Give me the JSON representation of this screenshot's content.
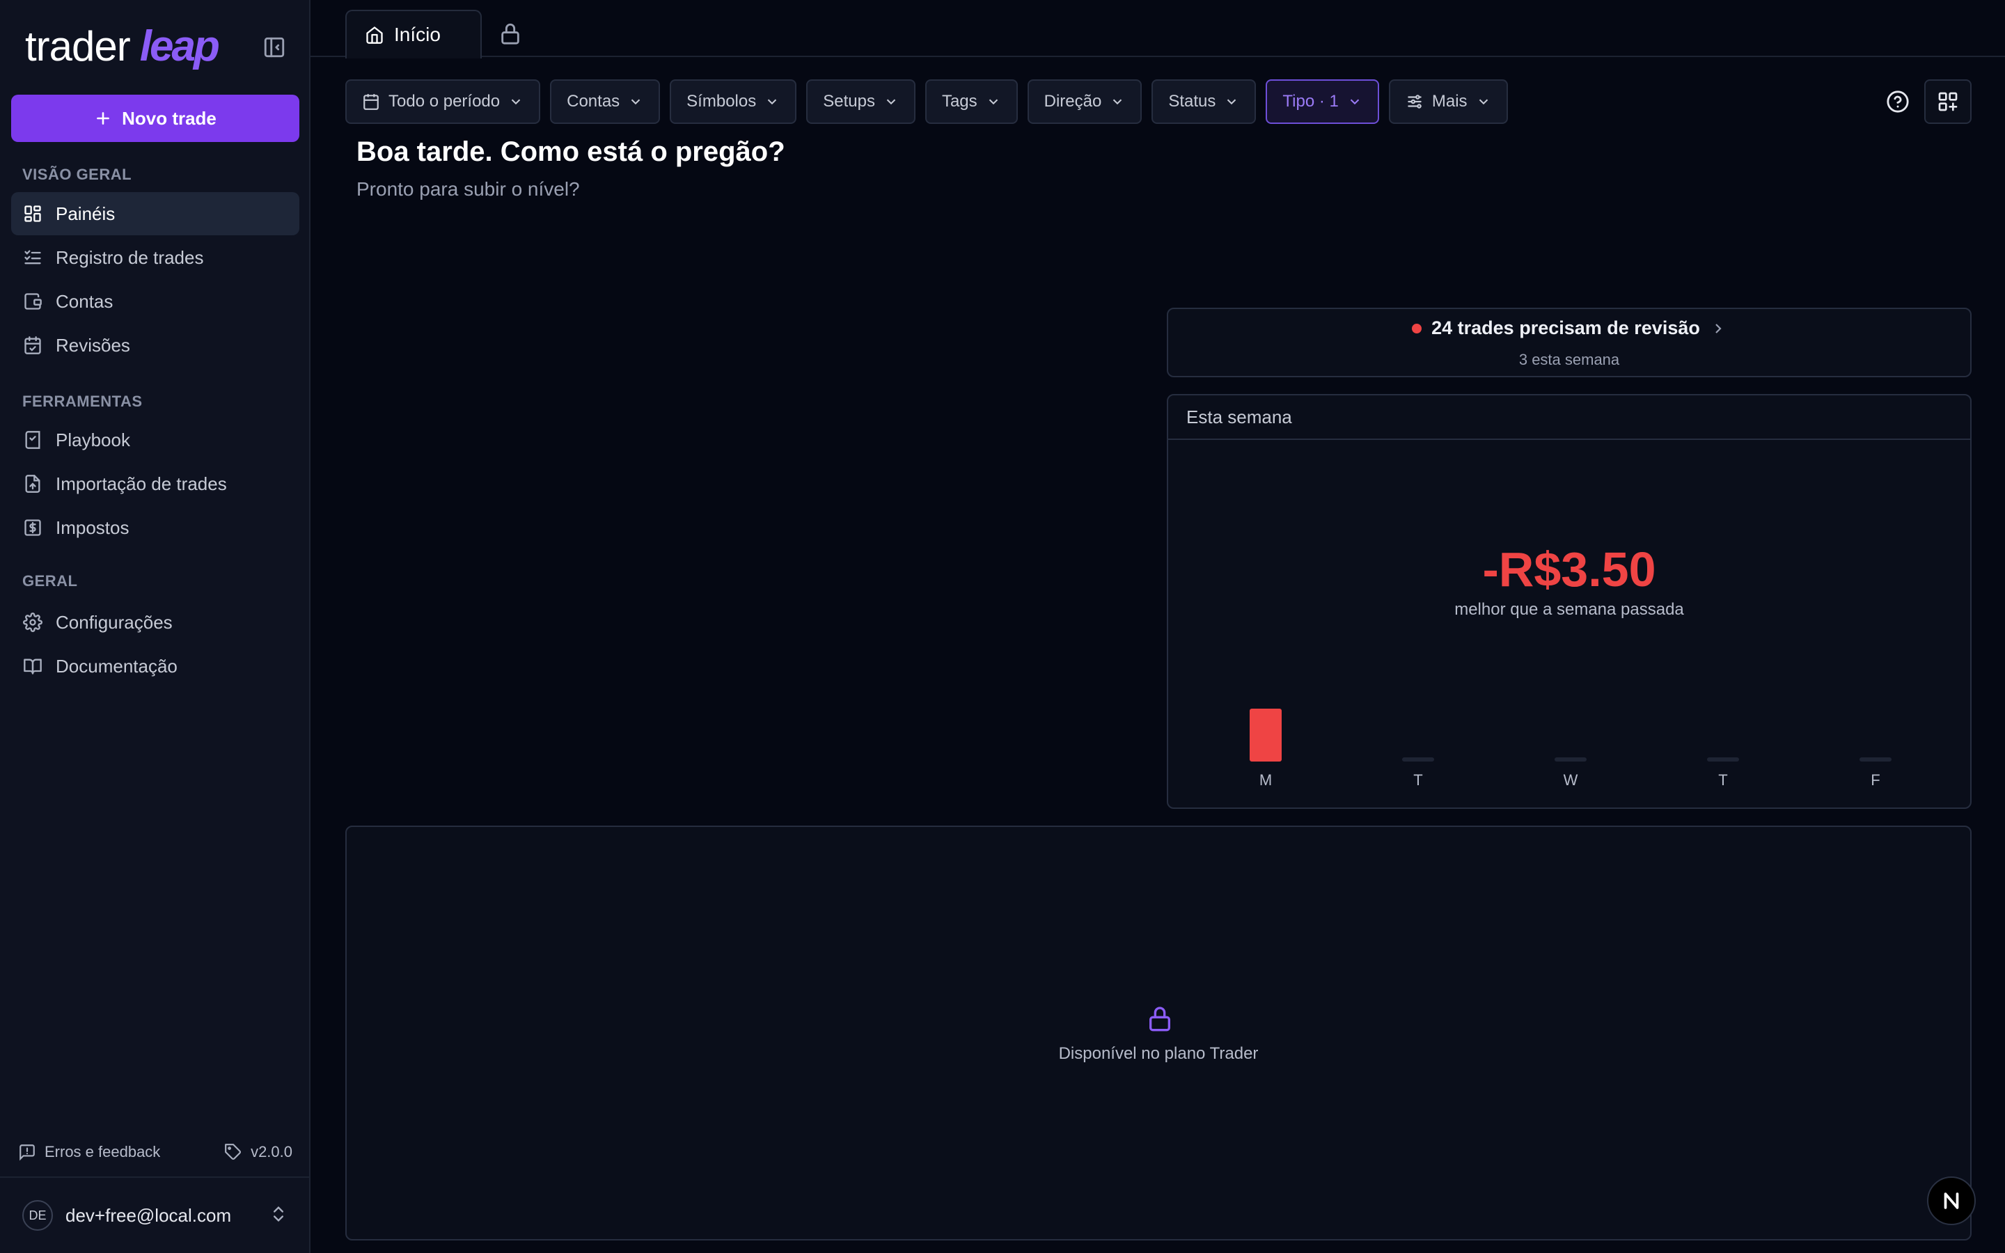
{
  "app": {
    "logo_text": "trader",
    "logo_accent": "leap"
  },
  "sidebar": {
    "new_trade_label": "Novo trade",
    "sections": [
      {
        "title": "VISÃO GERAL"
      },
      {
        "title": "FERRAMENTAS"
      },
      {
        "title": "GERAL"
      }
    ],
    "items": [
      {
        "label": "Painéis",
        "icon": "dashboard-icon",
        "active": true
      },
      {
        "label": "Registro de trades",
        "icon": "checklist-icon"
      },
      {
        "label": "Contas",
        "icon": "wallet-icon"
      },
      {
        "label": "Revisões",
        "icon": "calendar-check-icon"
      },
      {
        "label": "Playbook",
        "icon": "book-check-icon"
      },
      {
        "label": "Importação de trades",
        "icon": "file-upload-icon"
      },
      {
        "label": "Impostos",
        "icon": "dollar-receipt-icon"
      },
      {
        "label": "Configurações",
        "icon": "gear-icon"
      },
      {
        "label": "Documentação",
        "icon": "open-book-icon"
      }
    ],
    "footer": {
      "feedback_label": "Erros e feedback",
      "version": "v2.0.0"
    },
    "user": {
      "initials": "DE",
      "email": "dev+free@local.com"
    }
  },
  "tabs": {
    "home_label": "Início"
  },
  "filters": [
    {
      "label": "Todo o período",
      "icon": "calendar-icon"
    },
    {
      "label": "Contas"
    },
    {
      "label": "Símbolos"
    },
    {
      "label": "Setups"
    },
    {
      "label": "Tags"
    },
    {
      "label": "Direção"
    },
    {
      "label": "Status"
    },
    {
      "label": "Tipo · 1",
      "accent": true
    },
    {
      "label": "Mais",
      "icon": "sliders-icon"
    }
  ],
  "main": {
    "greeting": "Boa tarde. Como está o pregão?",
    "sub_greeting": "Pronto para subir o nível?"
  },
  "review": {
    "title": "24 trades precisam de revisão",
    "subtitle": "3 esta semana"
  },
  "week": {
    "title": "Esta semana",
    "amount": "-R$3.50",
    "compare": "melhor que a semana passada"
  },
  "chart_data": {
    "type": "bar",
    "categories": [
      "M",
      "T",
      "W",
      "T",
      "F"
    ],
    "values": [
      -3.5,
      0,
      0,
      0,
      0
    ],
    "title": "",
    "xlabel": "",
    "ylabel": ""
  },
  "locked": {
    "text": "Disponível no plano Trader"
  },
  "colors": {
    "accent": "#7c3aed",
    "negative": "#ef4444",
    "background": "#050813",
    "sidebar": "#0e1220"
  }
}
